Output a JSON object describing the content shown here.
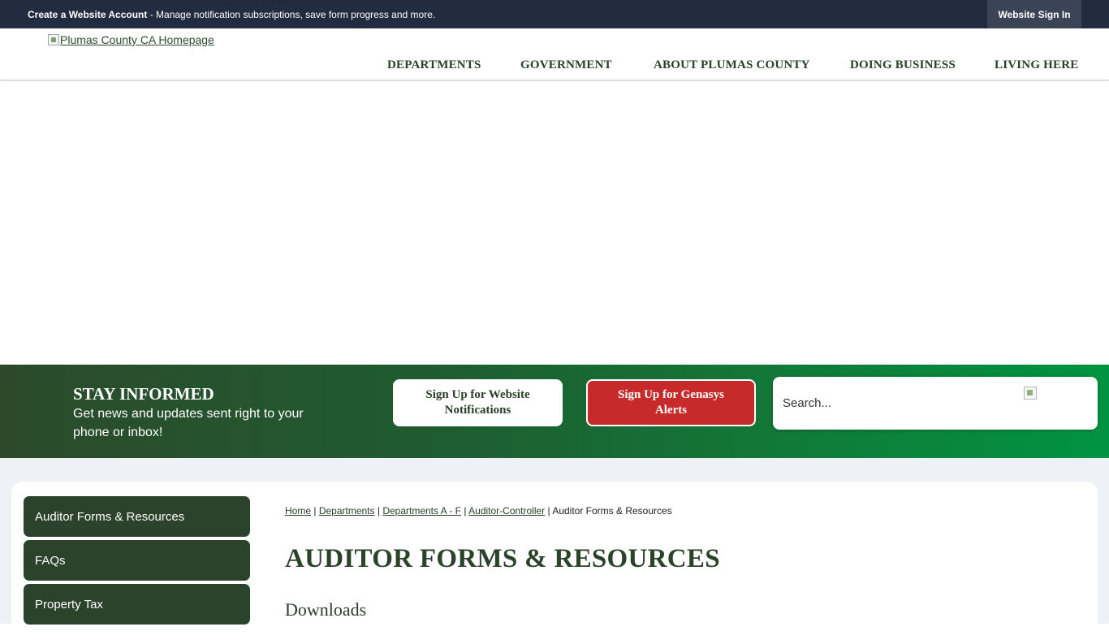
{
  "topbar": {
    "account_strong": "Create a Website Account",
    "account_rest": " - Manage notification subscriptions, save form progress and more.",
    "signin_label": "Website Sign In"
  },
  "header": {
    "logo_alt": "Plumas County CA Homepage",
    "nav": [
      "DEPARTMENTS",
      "GOVERNMENT",
      "ABOUT PLUMAS COUNTY",
      "DOING BUSINESS",
      "LIVING HERE"
    ]
  },
  "band": {
    "title": "STAY INFORMED",
    "description": "Get news and updates sent right to your phone or inbox!",
    "web_button": "Sign Up for Website Notifications",
    "genasys_button": "Sign Up for Genasys Alerts",
    "search_placeholder": "Search..."
  },
  "sidebar": {
    "items": [
      "Auditor Forms & Resources",
      "FAQs",
      "Property Tax"
    ]
  },
  "breadcrumb": {
    "links": [
      "Home",
      "Departments",
      "Departments A - F",
      "Auditor-Controller"
    ],
    "current": "Auditor Forms & Resources",
    "separator": " | "
  },
  "main": {
    "title": "AUDITOR FORMS & RESOURCES",
    "section": "Downloads"
  },
  "colors": {
    "topbar": "#212c40",
    "brand_green": "#2b432b",
    "alert_red": "#c62a2a",
    "content_bg": "#eef1f6"
  }
}
